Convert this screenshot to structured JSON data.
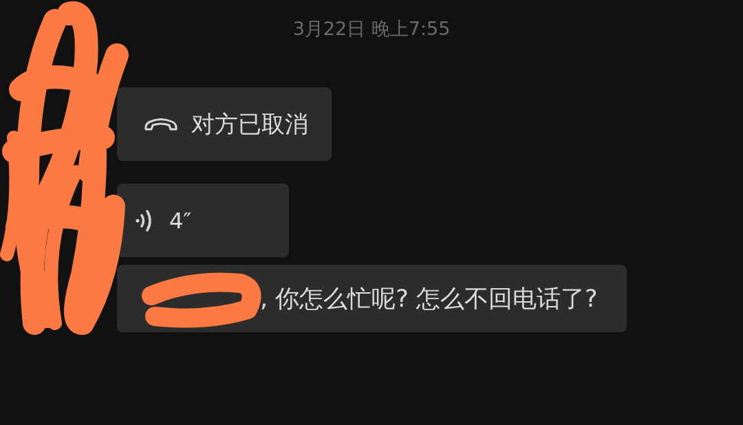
{
  "timestamp": "3月22日 晚上7:55",
  "messages": [
    {
      "kind": "call",
      "text": "对方已取消"
    },
    {
      "kind": "voice",
      "text": "4″"
    },
    {
      "kind": "text",
      "text": ", 你怎么忙呢? 怎么不回电话了?"
    }
  ]
}
